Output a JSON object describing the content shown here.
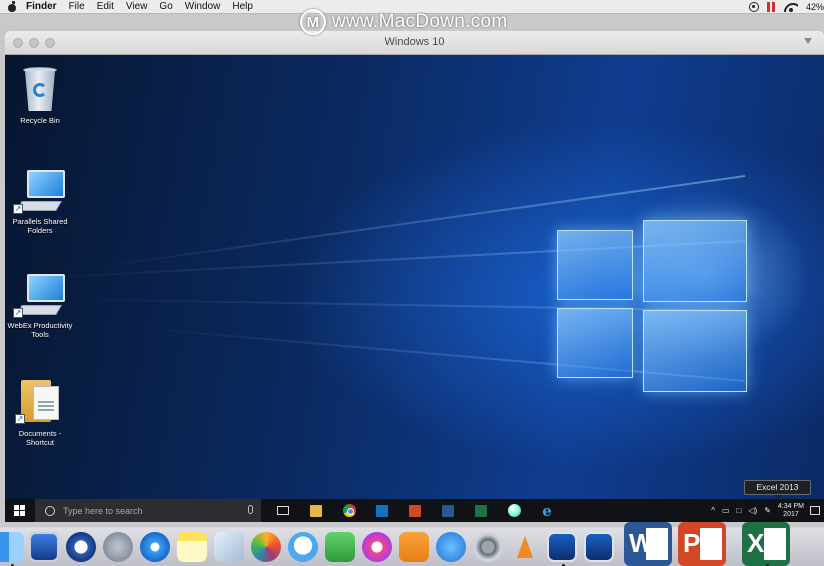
{
  "menubar": {
    "items": [
      "Finder",
      "File",
      "Edit",
      "View",
      "Go",
      "Window",
      "Help"
    ],
    "battery": "42%"
  },
  "watermark": {
    "logo_letter": "M",
    "text": "www.MacDown.com"
  },
  "vm_window": {
    "title": "Windows 10"
  },
  "desktop": {
    "icons": [
      {
        "label": "Recycle Bin"
      },
      {
        "label": "Parallels Shared Folders"
      },
      {
        "label": "WebEx Productivity Tools"
      },
      {
        "label": "Documents - Shortcut"
      }
    ]
  },
  "taskbar": {
    "search_placeholder": "Type here to search",
    "pinned": [
      "task-view",
      "file-explorer",
      "chrome",
      "outlook",
      "powerpoint",
      "word",
      "excel",
      "sphere-app",
      "edge"
    ],
    "clock_time": "4:34 PM",
    "clock_date": "2017",
    "tooltip": "Excel 2013"
  },
  "dock": {
    "apps": [
      "finder",
      "mission-control",
      "quicktime",
      "launchpad",
      "safari",
      "notes",
      "preview",
      "photos",
      "messages",
      "facetime",
      "itunes",
      "ibooks",
      "app-store",
      "system-preferences",
      "vlc",
      "parallels-windows",
      "parallels-vm",
      "word",
      "powerpoint",
      "excel"
    ],
    "letters": {
      "word": "W",
      "powerpoint": "P",
      "excel": "X"
    }
  }
}
